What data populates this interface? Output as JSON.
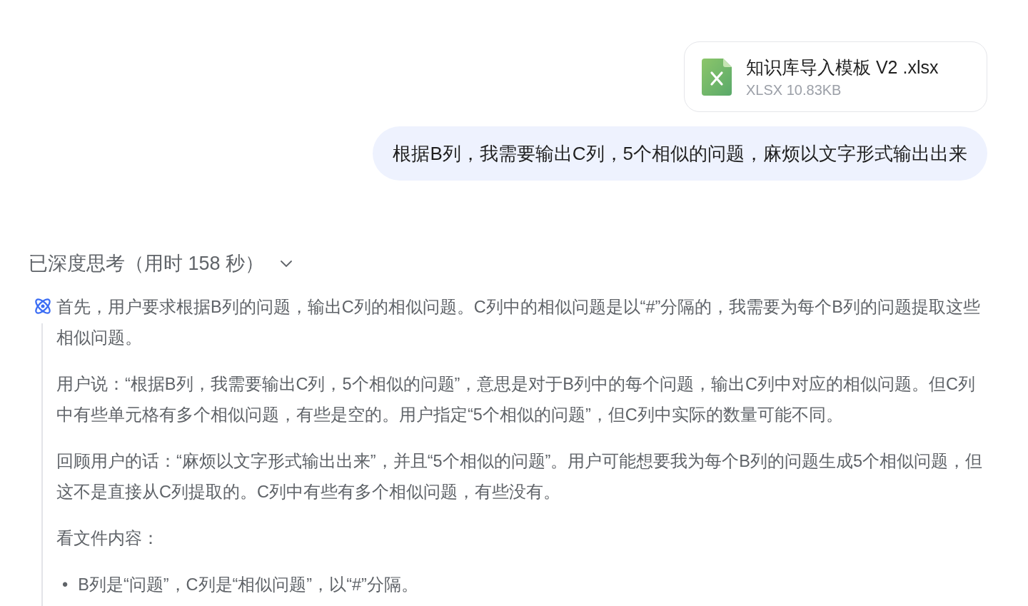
{
  "attachment": {
    "name": "知识库导入模板 V2 .xlsx",
    "meta": "XLSX 10.83KB"
  },
  "user_message": "根据B列，我需要输出C列，5个相似的问题，麻烦以文字形式输出出来",
  "thinking": {
    "title": "已深度思考（用时 158 秒）",
    "expanded": true,
    "paragraphs": [
      "首先，用户要求根据B列的问题，输出C列的相似问题。C列中的相似问题是以“#”分隔的，我需要为每个B列的问题提取这些相似问题。",
      "用户说：“根据B列，我需要输出C列，5个相似的问题”，意思是对于B列中的每个问题，输出C列中对应的相似问题。但C列中有些单元格有多个相似问题，有些是空的。用户指定“5个相似的问题”，但C列中实际的数量可能不同。",
      "回顾用户的话：“麻烦以文字形式输出出来”，并且“5个相似的问题”。用户可能想要我为每个B列的问题生成5个相似问题，但这不是直接从C列提取的。C列中有些有多个相似问题，有些没有。",
      "看文件内容："
    ],
    "bullets": [
      {
        "marker": "•",
        "text": "B列是“问题”，C列是“相似问题”，以“#”分隔。"
      }
    ]
  }
}
